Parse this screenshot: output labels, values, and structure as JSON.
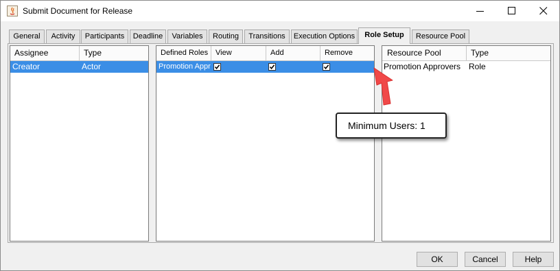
{
  "window": {
    "title": "Submit Document for Release",
    "controls": {
      "minimize": "minimize-icon",
      "maximize": "maximize-icon",
      "close": "close-icon"
    }
  },
  "tabs": [
    {
      "label": "General"
    },
    {
      "label": "Activity"
    },
    {
      "label": "Participants"
    },
    {
      "label": "Deadline"
    },
    {
      "label": "Variables"
    },
    {
      "label": "Routing"
    },
    {
      "label": "Transitions"
    },
    {
      "label": "Execution Options"
    },
    {
      "label": "Role Setup",
      "active": true
    },
    {
      "label": "Resource Pool"
    }
  ],
  "assignee_table": {
    "columns": [
      "Assignee",
      "Type"
    ],
    "rows": [
      {
        "assignee": "Creator",
        "type": "Actor",
        "selected": true
      }
    ]
  },
  "roles_table": {
    "columns": [
      "Defined Roles",
      "View",
      "Add",
      "Remove"
    ],
    "rows": [
      {
        "role": "Promotion Appr",
        "view": true,
        "add": true,
        "remove": true,
        "selected": true
      }
    ]
  },
  "pool_table": {
    "columns": [
      "Resource Pool",
      "Type"
    ],
    "rows": [
      {
        "pool": "Promotion Approvers",
        "type": "Role"
      }
    ]
  },
  "annotation": {
    "tooltip": "Minimum Users: 1",
    "arrow_color": "#f04848"
  },
  "buttons": {
    "ok": "OK",
    "cancel": "Cancel",
    "help": "Help"
  },
  "colors": {
    "selection": "#3b8ee6",
    "panel": "#f0f0f0"
  }
}
